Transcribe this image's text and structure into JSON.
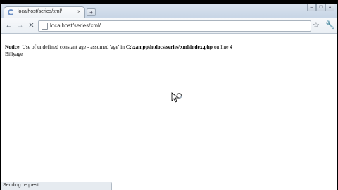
{
  "browser": {
    "tab": {
      "title": "localhost/series/xml/",
      "close_symbol": "×"
    },
    "new_tab_symbol": "+",
    "window_controls": {
      "minimize": "–",
      "maximize": "□",
      "close": "×"
    },
    "nav": {
      "back": "←",
      "forward": "→",
      "stop": "✕"
    },
    "address_bar": {
      "url": "localhost/series/xml/"
    },
    "icons": {
      "tab": "loading-spinner",
      "page": "page-icon",
      "bookmark": "star-icon",
      "menu": "wrench-icon"
    }
  },
  "page": {
    "notice": {
      "label": "Notice",
      "message": ": Use of undefined constant age - assumed 'age' in ",
      "path": "C:\\xampp\\htdocs\\series\\xml\\index.php",
      "line_prefix": " on line ",
      "line_number": "4"
    },
    "output": "Billyage"
  },
  "status_bar": {
    "text": "Sending request..."
  }
}
